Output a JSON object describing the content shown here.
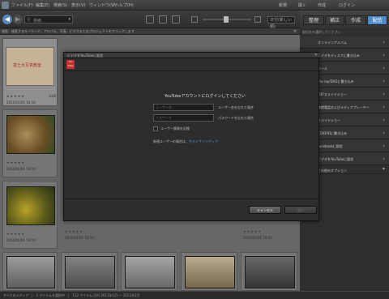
{
  "menubar": {
    "items": [
      "ファイル(F)",
      "編集(E)",
      "検索(S)",
      "表示(V)",
      "ウィンドウ(W)",
      "ヘルプ(H)"
    ],
    "right_items": [
      "新規",
      "開く",
      "作成",
      "ログイン"
    ]
  },
  "toolbar": {
    "search_placeholder": "検索"
  },
  "sort": {
    "value": "日付(新しい順)"
  },
  "modes": [
    "整理",
    "補正",
    "作成",
    "配信"
  ],
  "infobar": {
    "text": "検索：検索するキーワード、アルバム、写真、ビデオまたはプロジェクトをクリックします"
  },
  "grid": {
    "first_title": "富士大写真教室",
    "first_label": "1/40",
    "dates": [
      "2011/01/01 10:10",
      "2011/01/01 10:10",
      "2011/01/01 10:10",
      "2011/01/01 10:10",
      "2011/01/01 10:10"
    ]
  },
  "right_panel": {
    "heading": "配信先を選択してください",
    "items": [
      "オンラインアルバム",
      "ビデオをディスクに書き込み",
      "メール",
      "Blu-ray/DVDに書き込み",
      "PDFスライドショー",
      "携帯電話およびメディアプレーヤー",
      "スライドショー",
      "CD/DVDに書き込み",
      "Facebookに配信",
      "ビデオをYouTubeに配信",
      "その他のオプション"
    ]
  },
  "dialog": {
    "title": "ビデオをYouTubeに配信",
    "logo_text": "You Tube",
    "heading": "YouTubeアカウントにログインしてください",
    "username_placeholder": "ユーザー名",
    "password_placeholder": "パスワード",
    "username_note": "ユーザー名を忘れた場合",
    "password_note": "パスワードを忘れた場合",
    "remember_label": "ユーザー情報を記憶",
    "signup_prefix": "新規ユーザーの場合は、",
    "signup_link": "今すぐサインアップ",
    "cancel_label": "キャンセル",
    "ok_label": "次へ"
  },
  "statusbar": {
    "text": "すべてのメディア　|　1 アイテムを選択中　|　112 アイテム 日付 2011年1月 ～ 2011年1月"
  }
}
